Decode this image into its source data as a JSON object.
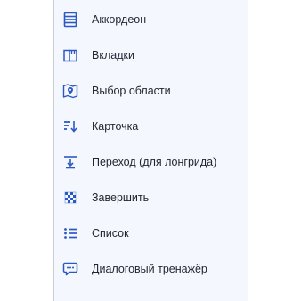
{
  "menu": {
    "accent_color": "#2b59c3",
    "items": [
      {
        "label": "Аккордеон",
        "icon": "accordion-icon"
      },
      {
        "label": "Вкладки",
        "icon": "tabs-icon"
      },
      {
        "label": "Выбор области",
        "icon": "map-pin-icon"
      },
      {
        "label": "Карточка",
        "icon": "sort-down-icon"
      },
      {
        "label": "Переход (для лонгрида)",
        "icon": "jump-down-icon"
      },
      {
        "label": "Завершить",
        "icon": "checkered-flag-icon"
      },
      {
        "label": "Список",
        "icon": "list-icon"
      },
      {
        "label": "Диалоговый тренажёр",
        "icon": "chat-bubble-icon"
      }
    ]
  }
}
